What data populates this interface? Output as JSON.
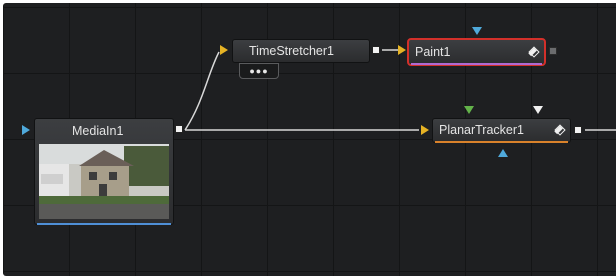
{
  "nodes": {
    "mediain": {
      "name": "MediaIn1",
      "has_thumbnail": true
    },
    "timestretcher": {
      "name": "TimeStretcher1",
      "badge": "●●●"
    },
    "paint": {
      "name": "Paint1",
      "selected": true
    },
    "planartracker": {
      "name": "PlanarTracker1"
    }
  },
  "colors": {
    "canvas": "#1e1f21",
    "wire": "#d8d8d8",
    "input_triangle": "#e5b224",
    "mask_triangle": "#4fa9db",
    "selection_outline": "#d3302a",
    "tracker_effect_mask_triangle": "#63b34a",
    "node_strip_orange": "#d9822b",
    "node_strip_purple": "#b06ad1",
    "node_strip_blue": "#4f8fd6"
  },
  "icons": [
    "input-triangle-icon",
    "output-square-icon",
    "mask-input-icon",
    "node-diamond-icon"
  ]
}
